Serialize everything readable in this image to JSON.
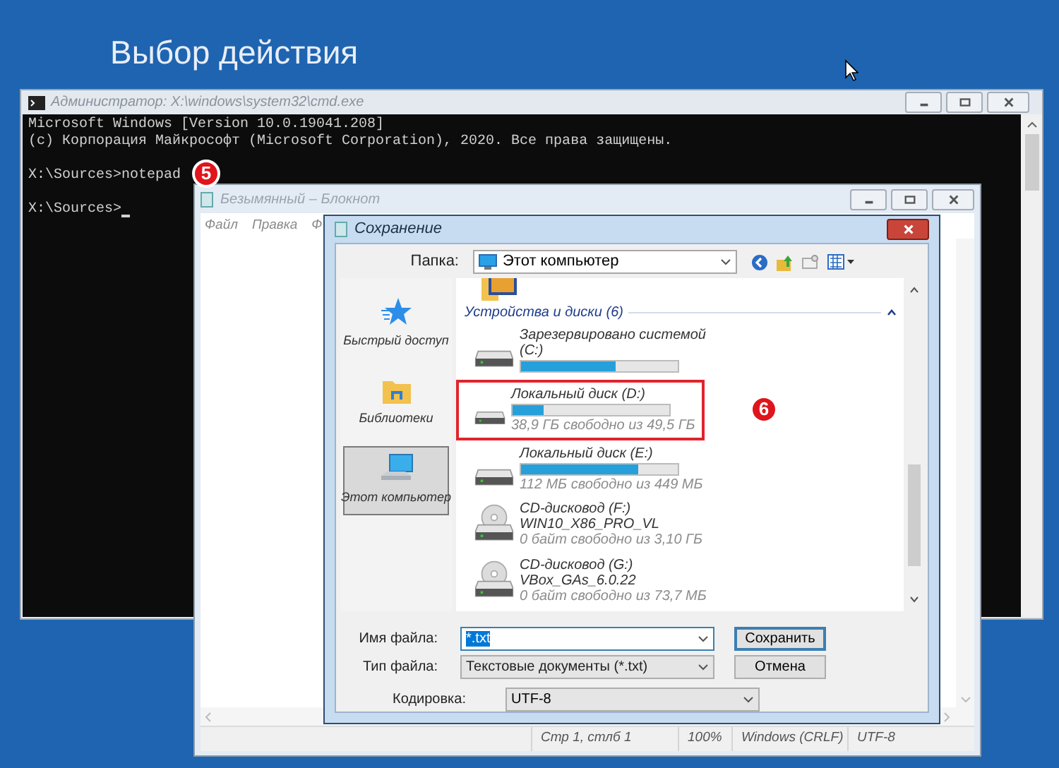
{
  "screen": {
    "title": "Выбор действия"
  },
  "cmd": {
    "title": "Администратор: X:\\windows\\system32\\cmd.exe",
    "lines": [
      {
        "text": "Microsoft Windows [Version 10.0.19041.208]",
        "blank_before": false,
        "cursor": false
      },
      {
        "text": "(c) Корпорация Майкрософт (Microsoft Corporation), 2020. Все права защищены.",
        "blank_before": false,
        "cursor": false
      },
      {
        "text": "X:\\Sources>notepad",
        "blank_before": true,
        "cursor": false
      },
      {
        "text": "X:\\Sources>",
        "blank_before": true,
        "cursor": true
      }
    ]
  },
  "notepad": {
    "title": "Безымянный – Блокнот",
    "menu": [
      "Файл",
      "Правка",
      "Ф"
    ],
    "status_bar": [
      "Стр 1, стлб 1",
      "100%",
      "Windows (CRLF)",
      "UTF-8"
    ]
  },
  "save_dialog": {
    "title": "Сохранение",
    "folder_label": "Папка:",
    "folder": "Этот компьютер",
    "nav": [
      {
        "label": "Быстрый доступ",
        "kind": "quick_access",
        "selected": false
      },
      {
        "label": "Библиотеки",
        "kind": "libraries",
        "selected": false
      },
      {
        "label": "Этот компьютер",
        "kind": "computer",
        "selected": true
      }
    ],
    "group": {
      "title": "Устройства и диски (6)",
      "expanded": true
    },
    "drives": [
      {
        "kind": "hdd",
        "name": "Зарезервировано системой (C:)",
        "level": 0.6,
        "highlighted": false
      },
      {
        "kind": "hdd",
        "name": "Локальный диск (D:)",
        "level": 0.2,
        "free": "38,9 ГБ свободно из 49,5 ГБ",
        "highlighted": true
      },
      {
        "kind": "hdd",
        "name": "Локальный диск (E:)",
        "level": 0.75,
        "free": "112 МБ свободно из 449 МБ",
        "highlighted": false
      },
      {
        "kind": "cd",
        "name": "CD-дисковод (F:)",
        "volume": "WIN10_X86_PRO_VL",
        "free": "0 байт свободно из 3,10 ГБ",
        "highlighted": false
      },
      {
        "kind": "cd",
        "name": "CD-дисковод (G:)",
        "volume": "VBox_GAs_6.0.22",
        "free": "0 байт свободно из 73,7 МБ",
        "highlighted": false
      }
    ],
    "file_name": {
      "label": "Имя файла:",
      "value": "*.txt"
    },
    "file_type": {
      "label": "Тип файла:",
      "value": "Текстовые документы (*.txt)"
    },
    "encoding": {
      "label": "Кодировка:",
      "value": "UTF-8"
    },
    "buttons": [
      "Сохранить",
      "Отмена"
    ]
  },
  "annotations": [
    {
      "label": "5"
    },
    {
      "label": "6"
    }
  ]
}
